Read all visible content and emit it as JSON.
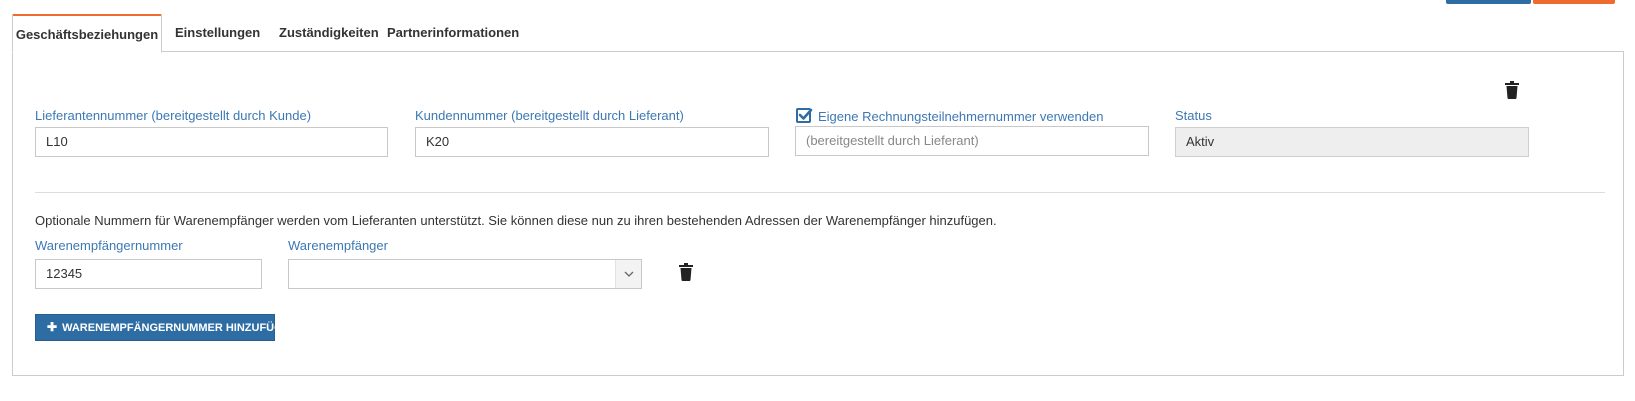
{
  "tabs": [
    {
      "label": "Geschäftsbeziehungen",
      "active": true
    },
    {
      "label": "Einstellungen"
    },
    {
      "label": "Zuständigkeiten"
    },
    {
      "label": "Partnerinformationen"
    }
  ],
  "form": {
    "supplier_number": {
      "label": "Lieferantennummer (bereitgestellt durch Kunde)",
      "value": "L10"
    },
    "customer_number": {
      "label": "Kundennummer (bereitgestellt durch Lieferant)",
      "value": "K20"
    },
    "invoice_participant": {
      "checkbox_label": "Eigene Rechnungsteilnehmernummer verwenden",
      "checked": true,
      "placeholder": "(bereitgestellt durch Lieferant)"
    },
    "status": {
      "label": "Status",
      "value": "Aktiv"
    }
  },
  "recipients": {
    "info_text": "Optionale Nummern für Warenempfänger werden vom Lieferanten unterstützt. Sie können diese nun zu ihren bestehenden Adressen der Warenempfänger hinzufügen.",
    "number_label": "Warenempfängernummer",
    "number_value": "12345",
    "recipient_label": "Warenempfänger",
    "recipient_value": "",
    "add_button_label": "WARENEMPFÄNGERNUMMER HINZUFÜGEN"
  },
  "colors": {
    "accent": "#2e6da4",
    "tab_highlight": "#ee6b2f",
    "label": "#3c78b4"
  },
  "icons": {
    "delete": "trash-icon",
    "add": "plus-icon",
    "dropdown": "chevron-down-icon",
    "checked": "check-icon"
  }
}
